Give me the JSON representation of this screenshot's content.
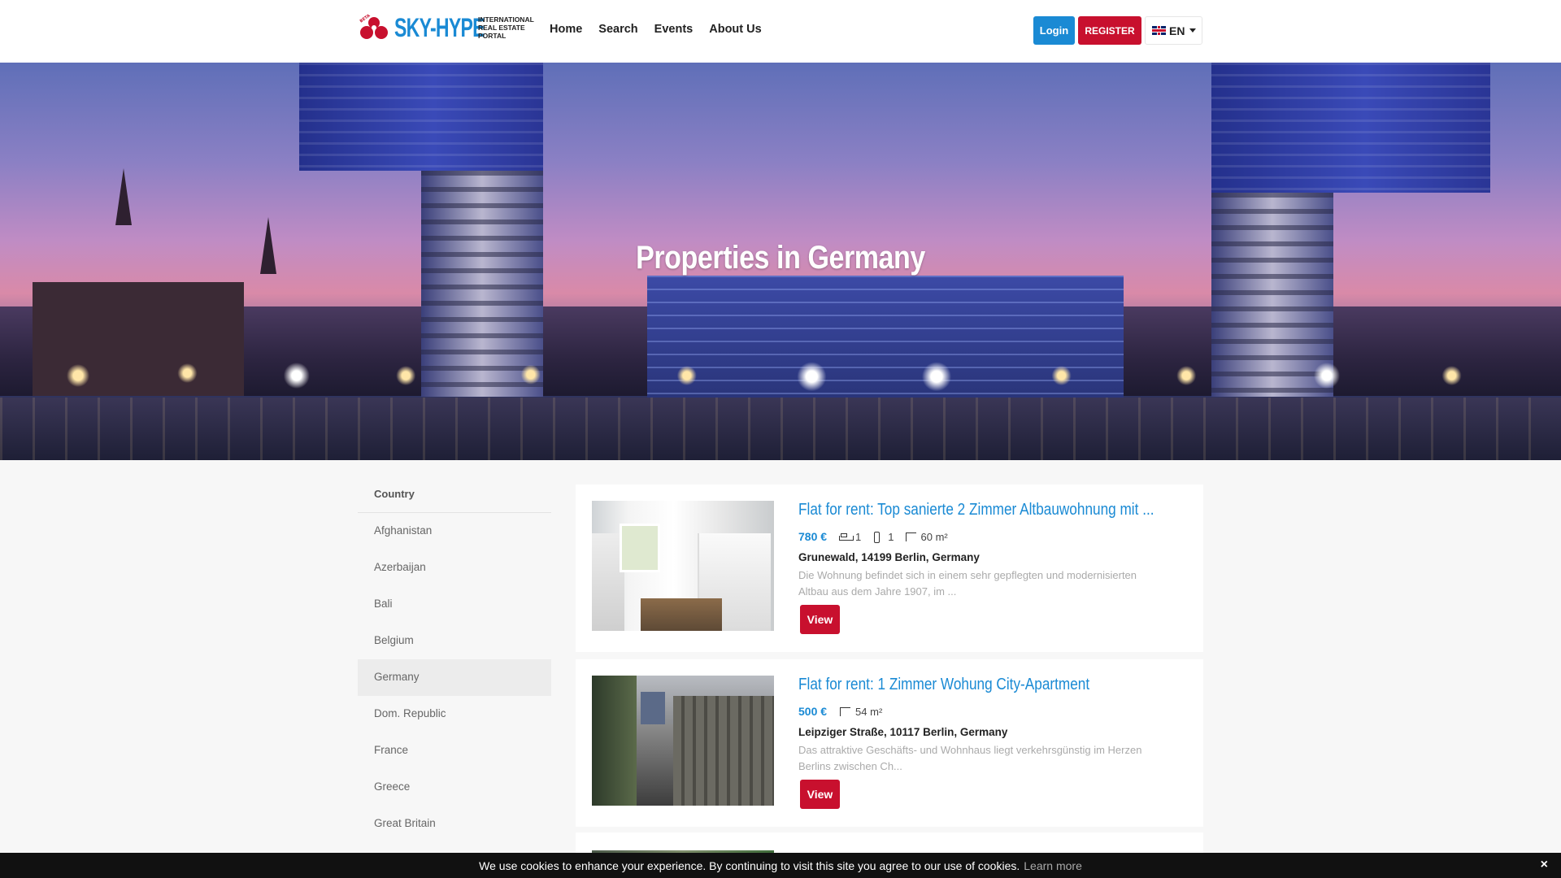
{
  "header": {
    "logo": {
      "beta": "BETA",
      "name": "SKY-HYPE",
      "subtitle": "INTERNATIONAL\nREAL ESTATE\nPORTAL"
    },
    "nav": [
      "Home",
      "Search",
      "Events",
      "About Us"
    ],
    "login_label": "Login",
    "register_label": "REGISTER",
    "language": "EN"
  },
  "hero": {
    "title": "Properties in Germany"
  },
  "sidebar": {
    "heading": "Country",
    "items": [
      "Afghanistan",
      "Azerbaijan",
      "Bali",
      "Belgium",
      "Germany",
      "Dom. Republic",
      "France",
      "Greece",
      "Great Britain"
    ],
    "active": "Germany"
  },
  "listings": [
    {
      "title": "Flat for rent: Top sanierte 2 Zimmer Altbauwohnung mit ...",
      "price": "780 €",
      "bedrooms": "1",
      "bathrooms": "1",
      "area": "60 m²",
      "address": "Grunewald, 14199 Berlin, Germany",
      "description": "Die Wohnung befindet sich in einem sehr gepflegten und modernisierten Altbau aus dem Jahre 1907, im ...",
      "view_label": "View"
    },
    {
      "title": "Flat for rent: 1 Zimmer Wohung City-Apartment",
      "price": "500 €",
      "area": "54 m²",
      "address": "Leipziger Straße, 10117 Berlin, Germany",
      "description": "Das attraktive Geschäfts- und Wohnhaus liegt verkehrsgünstig im Herzen Berlins zwischen Ch...",
      "view_label": "View"
    }
  ],
  "cookie": {
    "text": "We use cookies to enhance your experience. By continuing to visit this site you agree to our use of cookies.",
    "link": "Learn more",
    "close": "×"
  },
  "colors": {
    "brand_blue": "#1a8ad4",
    "brand_red": "#c8102e"
  }
}
